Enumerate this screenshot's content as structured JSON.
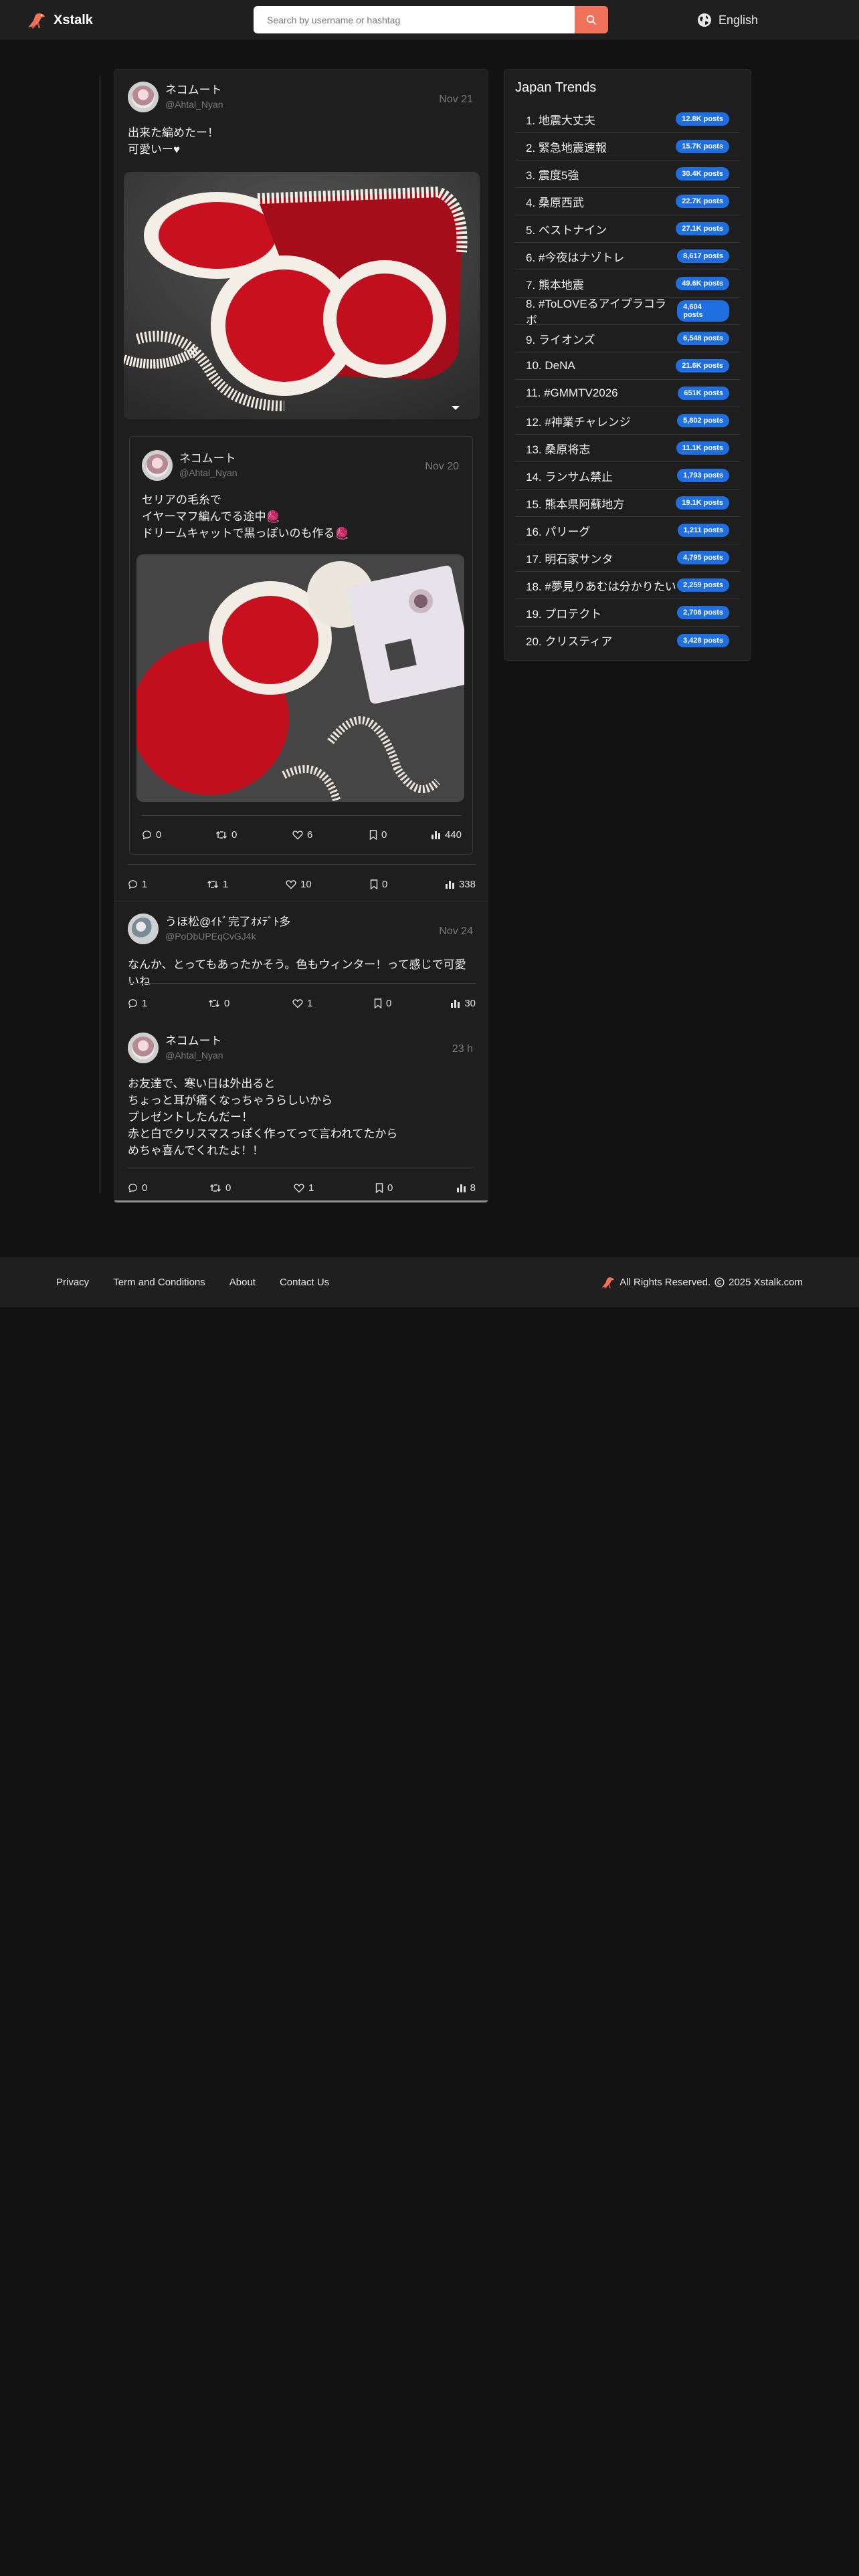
{
  "header": {
    "brand": "Xstalk",
    "search_placeholder": "Search by username or hashtag",
    "language": "English"
  },
  "main_post": {
    "user": {
      "name": "ネコムート",
      "handle": "@Ahtal_Nyan"
    },
    "date": "Nov 21",
    "text": "出来た編めたー！\n可愛いー♥",
    "stats": {
      "replies": "1",
      "reposts": "1",
      "likes": "10",
      "bookmarks": "0",
      "views": "338"
    },
    "quoted": {
      "user": {
        "name": "ネコムート",
        "handle": "@Ahtal_Nyan"
      },
      "date": "Nov 20",
      "text": "セリアの毛糸で\nイヤーマフ編んでる途中🧶\nドリームキャットで黒っぽいのも作る🧶",
      "stats": {
        "replies": "0",
        "reposts": "0",
        "likes": "6",
        "bookmarks": "0",
        "views": "440"
      }
    }
  },
  "replies": [
    {
      "user": {
        "name": "うほ松@ｲﾄﾞ完了ｵﾒﾃﾞﾄ多",
        "handle": "@PoDbUPEqCvGJ4k"
      },
      "date": "Nov 24",
      "text": "なんか、とってもあったかそう。色もウィンター！って感じで可愛いね",
      "stats": {
        "replies": "1",
        "reposts": "0",
        "likes": "1",
        "bookmarks": "0",
        "views": "30"
      }
    },
    {
      "user": {
        "name": "ネコムート",
        "handle": "@Ahtal_Nyan"
      },
      "date": "23 h",
      "text": "お友達で、寒い日は外出ると\nちょっと耳が痛くなっちゃうらしいから\nプレゼントしたんだー！\n赤と白でクリスマスっぽく作ってって言われてたから\nめちゃ喜んでくれたよ！！",
      "stats": {
        "replies": "0",
        "reposts": "0",
        "likes": "1",
        "bookmarks": "0",
        "views": "8"
      }
    }
  ],
  "trends": {
    "title": "Japan Trends",
    "items": [
      {
        "label": "1. 地震大丈夫",
        "count": "12.8K posts"
      },
      {
        "label": "2. 緊急地震速報",
        "count": "15.7K posts"
      },
      {
        "label": "3. 震度5強",
        "count": "30.4K posts"
      },
      {
        "label": "4. 桑原西武",
        "count": "22.7K posts"
      },
      {
        "label": "5. ベストナイン",
        "count": "27.1K posts"
      },
      {
        "label": "6. #今夜はナゾトレ",
        "count": "8,617 posts"
      },
      {
        "label": "7. 熊本地震",
        "count": "49.6K posts"
      },
      {
        "label": "8. #ToLOVEるアイプラコラボ",
        "count": "4,604 posts"
      },
      {
        "label": "9. ライオンズ",
        "count": "6,548 posts"
      },
      {
        "label": "10. DeNA",
        "count": "21.6K posts"
      },
      {
        "label": "11. #GMMTV2026",
        "count": "651K posts"
      },
      {
        "label": "12. #神業チャレンジ",
        "count": "5,802 posts"
      },
      {
        "label": "13. 桑原将志",
        "count": "11.1K posts"
      },
      {
        "label": "14. ランサム禁止",
        "count": "1,793 posts"
      },
      {
        "label": "15. 熊本県阿蘇地方",
        "count": "19.1K posts"
      },
      {
        "label": "16. パリーグ",
        "count": "1,211 posts"
      },
      {
        "label": "17. 明石家サンタ",
        "count": "4,795 posts"
      },
      {
        "label": "18. #夢見りあむは分かりたい",
        "count": "2,259 posts"
      },
      {
        "label": "19. プロテクト",
        "count": "2,706 posts"
      },
      {
        "label": "20. クリスティア",
        "count": "3,428 posts"
      }
    ]
  },
  "footer": {
    "links": [
      "Privacy",
      "Term and Conditions",
      "About",
      "Contact Us"
    ],
    "copyright_left": "All Rights Reserved.",
    "copyright_right": "2025 Xstalk.com"
  },
  "icons": {
    "brand": "dinosaur-logo-icon",
    "search": "search-icon",
    "language": "globe-icon",
    "reply": "comment-icon",
    "repost": "repost-icon",
    "like": "heart-icon",
    "bookmark": "bookmark-icon",
    "views": "bar-chart-icon",
    "copyright": "copyright-icon"
  },
  "colors": {
    "accent": "#f0725a",
    "badge": "#1f6fe0",
    "background": "#121212",
    "card": "#1e1e1e"
  }
}
